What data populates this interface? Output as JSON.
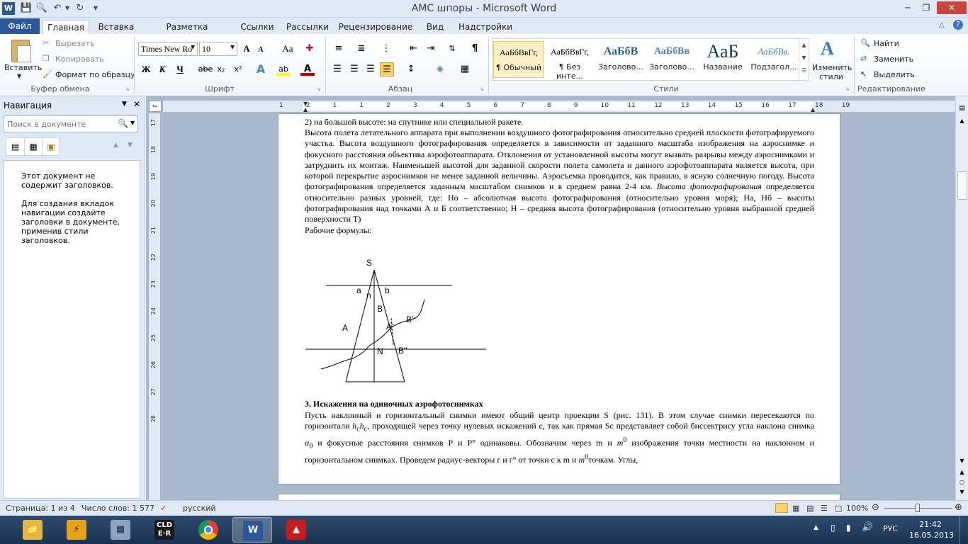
{
  "window": {
    "title": "АМС шпоры  -  Microsoft Word"
  },
  "quick_access": {
    "icons": [
      "word-icon",
      "save-icon",
      "print-preview-icon",
      "undo-icon",
      "redo-icon",
      "customize-icon"
    ]
  },
  "tabs": [
    {
      "label": "Файл"
    },
    {
      "label": "Главная"
    },
    {
      "label": "Вставка"
    },
    {
      "label": "Разметка страницы"
    },
    {
      "label": "Ссылки"
    },
    {
      "label": "Рассылки"
    },
    {
      "label": "Рецензирование"
    },
    {
      "label": "Вид"
    },
    {
      "label": "Надстройки"
    }
  ],
  "ribbon": {
    "clipboard": {
      "paste": "Вставить",
      "cut": "Вырезать",
      "copy": "Копировать",
      "format_painter": "Формат по образцу",
      "group": "Буфер обмена"
    },
    "font": {
      "name": "Times New Ro",
      "size": "10",
      "group": "Шрифт",
      "bold": "Ж",
      "italic": "К",
      "underline": "Ч",
      "strike": "abe",
      "sub": "x₂",
      "sup": "x²",
      "grow": "A",
      "shrink": "A",
      "case": "Aa",
      "highlight": "ab",
      "color": "A"
    },
    "paragraph": {
      "group": "Абзац"
    },
    "styles": {
      "group": "Стили",
      "items": [
        {
          "sample": "АаБбВвГг,",
          "name": "¶ Обычный",
          "color": "#000000",
          "size": "12px"
        },
        {
          "sample": "АаБбВвГг,",
          "name": "¶ Без инте...",
          "color": "#000000",
          "size": "12px"
        },
        {
          "sample": "АаБбВ",
          "name": "Заголово...",
          "color": "#2e5f97",
          "size": "16px"
        },
        {
          "sample": "АаБбВв",
          "name": "Заголово...",
          "color": "#4f81bd",
          "size": "14px"
        },
        {
          "sample": "АаБ",
          "name": "Название",
          "color": "#17365d",
          "size": "26px"
        },
        {
          "sample": "АаБбВв.",
          "name": "Подзагол...",
          "color": "#4f81bd",
          "size": "13px"
        }
      ],
      "change": "Изменить стили"
    },
    "editing": {
      "find": "Найти",
      "replace": "Заменить",
      "select": "Выделить",
      "group": "Редактирование"
    }
  },
  "navigation": {
    "title": "Навигация",
    "search_placeholder": "Поиск в документе",
    "message1": "Этот документ не содержит заголовков.",
    "message2": "Для создания вкладок навигации создайте заголовки в документе, применив стили заголовков."
  },
  "document": {
    "line1": "2)       на большой высоте: на спутнике или специальной ракете.",
    "para1": "Высота полета летательного аппарата при выполнении воздушного фотографирования относительно средней плоскости фотографируемого участка. Высота воздушного фотографирования определяется в зависимости от заданного масштаба изображения на аэроснимке и фокусного расстояния объектива аэрофотоаппарата. Отклонения от установленной высоты могут вызвать разрывы между аэроснимками и затруднить их монтаж. Наименьшей высотой для заданной скорости полета самолета и данного аэрофотоаппарата является высота, при которой перекрытие аэроснимков не менее заданной величины. Аэросъемка проводится, как правило, в ясную солнечную погоду. Высота фотографирования определяется заданным масштабом снимков и в среднем равна 2-4 км.",
    "para1_italic": "Высота фотографирования",
    "para1_tail": "определяется относительно разных уровней, где: Но – абсолютная высота фотографирования (относительно уровня моря); На, Нб – высоты фотографирования над точками А и Б соответственно; Н – средняя высота фотографирования (относительно уровня выбранной средней поверхности Т)",
    "formulas": "Рабочие формулы:",
    "figure_labels": {
      "S": "S",
      "a": "a",
      "b": "b",
      "n": "n",
      "B": "B",
      "A": "A",
      "B1": "B'",
      "A1": "A'",
      "N": "N",
      "B2": "B''"
    },
    "heading3": "3. Искажения на одиночных аэрофотоснимках",
    "para2a": "Пусть наклонный и горизонтальный снимки имеют общий центр проекции  S  (рис. 131). В этом случае снимки пересекаются по горизонтали ",
    "para2_hh": "h",
    "para2_sub": "c",
    "para2b": ", проходящей через точку нулевых искажений с, так как прямая Sc представляет собой биссектрису угла наклона снимка ",
    "para2_alpha": "α",
    "para2_zero": "0",
    "para2c": " и фокусные расстояния снимков Р и Р° одинаковы. Обозначим через m и ",
    "para2_m": "m",
    "para2_deg": "0",
    "para2d": " изображения точки местности на наклонном и горизонтальном снимках. Проведем радиус-векторы г и г° от точки с к m и ",
    "para2e": "точкам. Углы,"
  },
  "ruler": {
    "h_ticks": [
      "1",
      "2",
      "1",
      "1",
      "2",
      "3",
      "4",
      "5",
      "6",
      "7",
      "8",
      "9",
      "10",
      "11",
      "12",
      "13",
      "14",
      "15",
      "16",
      "17",
      "18",
      "19"
    ],
    "v_ticks": [
      "17",
      "18",
      "19",
      "20",
      "21",
      "22",
      "23",
      "24",
      "25",
      "26",
      "27",
      "28"
    ]
  },
  "status": {
    "page": "Страница: 1 из 4",
    "words": "Число слов: 1 577",
    "lang": "русский",
    "zoom": "100%"
  },
  "taskbar": {
    "time": "21:42",
    "date": "16.05.2013",
    "lang": "РУС",
    "cld": "CLD\nE·R"
  }
}
